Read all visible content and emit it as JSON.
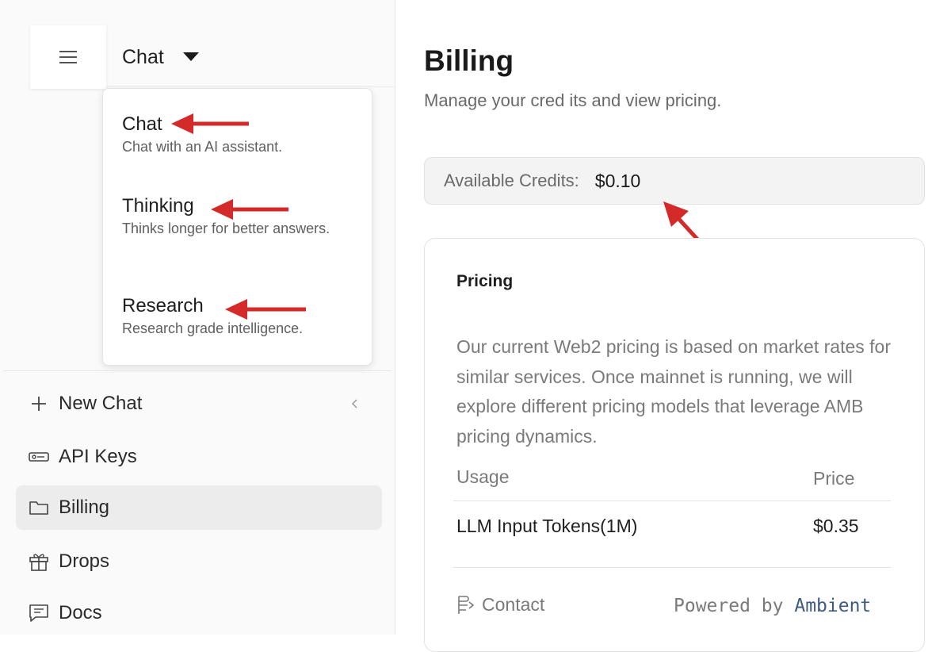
{
  "sidebar": {
    "mode_selector": {
      "selected": "Chat"
    },
    "mode_options": [
      {
        "title": "Chat",
        "description": "Chat with an AI assistant."
      },
      {
        "title": "Thinking",
        "description": "Thinks longer for better answers."
      },
      {
        "title": "Research",
        "description": "Research grade intelligence."
      }
    ],
    "nav": [
      {
        "label": "New Chat",
        "icon": "plus-icon"
      },
      {
        "label": "API Keys",
        "icon": "key-icon"
      },
      {
        "label": "Billing",
        "icon": "folder-icon",
        "active": true
      },
      {
        "label": "Drops",
        "icon": "gift-icon"
      },
      {
        "label": "Docs",
        "icon": "message-square-icon"
      }
    ]
  },
  "main": {
    "title": "Billing",
    "subtitle": "Manage your cred its and view pricing.",
    "credits": {
      "label": "Available Credits:",
      "value": "$0.10"
    },
    "pricing": {
      "title": "Pricing",
      "description": "Our current Web2 pricing is based on market rates for similar services. Once mainnet is running, we will explore different pricing models that leverage AMB pricing dynamics.",
      "columns": [
        "Usage",
        "Price"
      ],
      "rows": [
        {
          "usage": "LLM Input Tokens(1M)",
          "price": "$0.35"
        }
      ],
      "contact_label": "Contact",
      "powered_prefix": "Powered by",
      "powered_brand": "Ambient"
    }
  },
  "colors": {
    "annotation_arrow": "#d42a2a",
    "active_nav_bg": "#ececec",
    "brand_link": "#3d5a80"
  }
}
